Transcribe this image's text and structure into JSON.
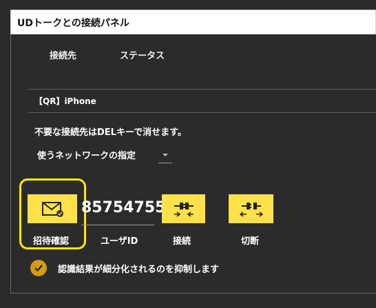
{
  "window": {
    "title": "UDトークとの接続パネル"
  },
  "tabs": [
    {
      "label": "接続先"
    },
    {
      "label": "ステータス"
    }
  ],
  "device": {
    "name": "【QR】iPhone"
  },
  "hint": "不要な接続先はDELキーで消せます。",
  "network": {
    "label": "使うネットワークの指定",
    "selected": ""
  },
  "actions": {
    "invite_label": "招待確認",
    "user_id_value": "85754755",
    "user_id_label": "ユーザID",
    "connect_label": "接続",
    "disconnect_label": "切断"
  },
  "option": {
    "checked": true,
    "label": "認識結果が細分化されるのを抑制します"
  },
  "colors": {
    "accent_yellow": "#ffe14a",
    "highlight_yellow": "#ffeb00",
    "check_orange": "#d69a0e",
    "background": "#2b2b2b"
  }
}
